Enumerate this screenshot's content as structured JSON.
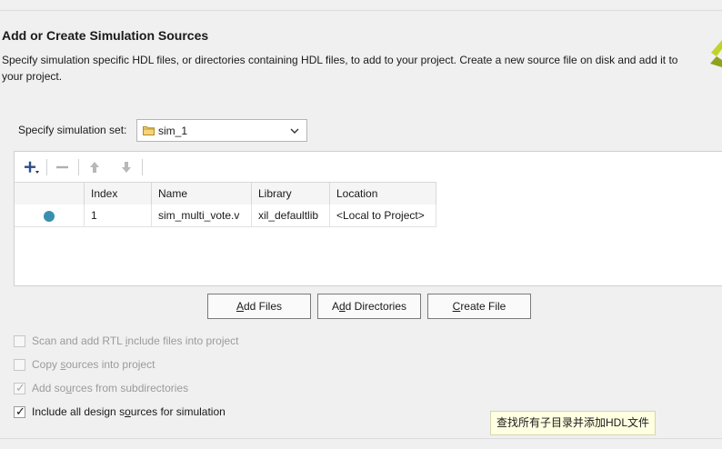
{
  "page": {
    "title": "Add or Create Simulation Sources",
    "description": "Specify simulation specific HDL files, or directories containing HDL files, to add to your project. Create a new source file on disk and add it to your project."
  },
  "simulation_set": {
    "label": "Specify simulation set:",
    "value": "sim_1"
  },
  "toolbar": {
    "icons": [
      "add-icon",
      "remove-icon",
      "move-up-icon",
      "move-down-icon"
    ]
  },
  "table": {
    "columns": [
      "",
      "Index",
      "Name",
      "Library",
      "Location"
    ],
    "rows": [
      {
        "index": "1",
        "name": "sim_multi_vote.v",
        "library": "xil_defaultlib",
        "location": "<Local to Project>"
      }
    ]
  },
  "buttons": {
    "add_files": {
      "pre": "",
      "u": "A",
      "post": "dd Files"
    },
    "add_directories": {
      "pre": "A",
      "u": "d",
      "post": "d Directories"
    },
    "create_file": {
      "pre": "",
      "u": "C",
      "post": "reate File"
    }
  },
  "options": [
    {
      "pre": "Scan and add RTL ",
      "u": "i",
      "post": "nclude files into project",
      "checked": false,
      "enabled": false
    },
    {
      "pre": "Copy ",
      "u": "s",
      "post": "ources into project",
      "checked": false,
      "enabled": false
    },
    {
      "pre": "Add so",
      "u": "u",
      "post": "rces from subdirectories",
      "checked": true,
      "enabled": false
    },
    {
      "pre": "Include all design s",
      "u": "o",
      "post": "urces for simulation",
      "checked": true,
      "enabled": true
    }
  ],
  "tooltip": "查找所有子目录并添加HDL文件",
  "colors": {
    "status_dot": "#3a8fb0",
    "accent_blue": "#2c4f8a",
    "tooltip_bg": "#ffffe1"
  }
}
